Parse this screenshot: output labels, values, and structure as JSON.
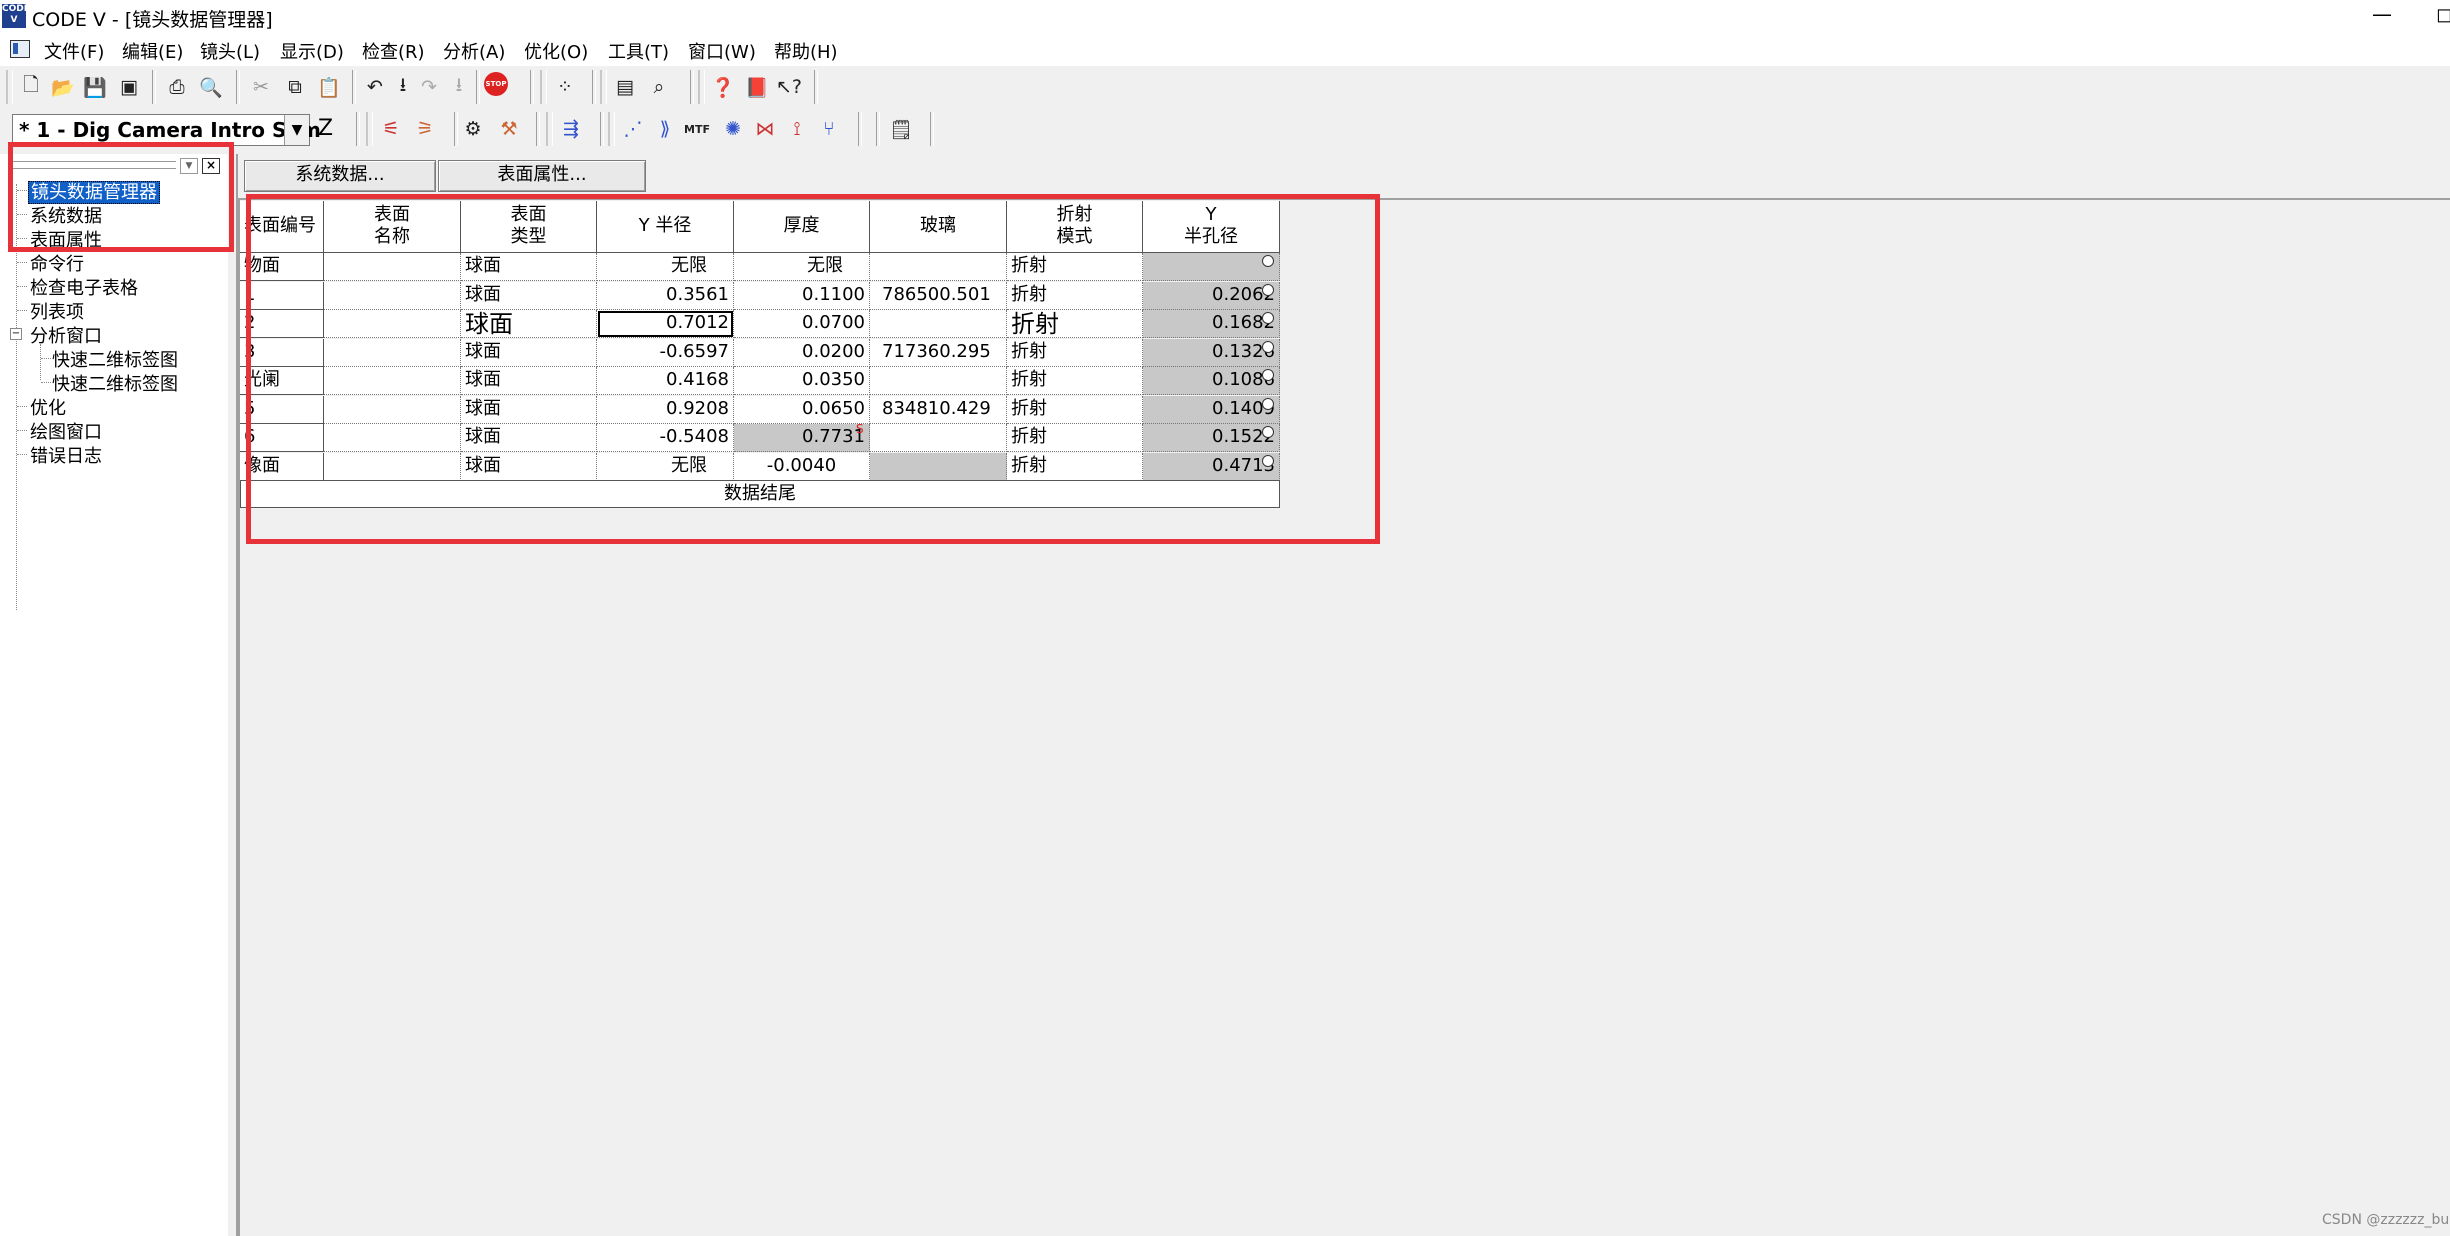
{
  "window": {
    "title": "CODE V - [镜头数据管理器]",
    "app_icon_label": "CODE V",
    "minimize_label": "—",
    "maximize_label": "◻"
  },
  "menu": {
    "items": [
      {
        "label": "文件(F)"
      },
      {
        "label": "编辑(E)"
      },
      {
        "label": "镜头(L)"
      },
      {
        "label": "显示(D)"
      },
      {
        "label": "检查(R)"
      },
      {
        "label": "分析(A)"
      },
      {
        "label": "优化(O)"
      },
      {
        "label": "工具(T)"
      },
      {
        "label": "窗口(W)"
      },
      {
        "label": "帮助(H)"
      }
    ]
  },
  "toolbar": {
    "lens_selector_value": "* 1 - Dig Camera Intro Sem",
    "z_label": "Z",
    "stop_label": "STOP",
    "mtf_label": "MTF",
    "icons": {
      "new": "new-file-icon",
      "open": "open-folder-icon",
      "save": "save-icon",
      "image": "image-icon",
      "print": "print-icon",
      "preview": "print-preview-icon",
      "cut": "cut-icon",
      "copy": "copy-icon",
      "paste": "paste-icon",
      "undo": "undo-icon",
      "redo": "redo-icon",
      "stop": "stop-icon"
    }
  },
  "tree": {
    "items": [
      {
        "label": "镜头数据管理器",
        "selected": true
      },
      {
        "label": "系统数据"
      },
      {
        "label": "表面属性"
      },
      {
        "label": "命令行"
      },
      {
        "label": "检查电子表格"
      },
      {
        "label": "列表项"
      },
      {
        "label": "分析窗口"
      },
      {
        "label": "快速二维标签图"
      },
      {
        "label": "快速二维标签图"
      },
      {
        "label": "优化"
      },
      {
        "label": "绘图窗口"
      },
      {
        "label": "错误日志"
      }
    ],
    "expander_label": "−"
  },
  "tabs": {
    "system_data": "系统数据...",
    "surface_props": "表面属性..."
  },
  "sheet": {
    "headers": [
      "表面编号",
      "表面\n名称",
      "表面\n类型",
      "Y 半径",
      "厚度",
      "玻璃",
      "折射\n模式",
      "Y\n半孔径"
    ],
    "rows": [
      {
        "id": "物面",
        "name": "",
        "type": "球面",
        "radius": "无限",
        "thickness": "无限",
        "glass": "",
        "mode": "折射",
        "aperture": ""
      },
      {
        "id": "1",
        "name": "",
        "type": "球面",
        "radius": "0.3561",
        "thickness": "0.1100",
        "glass": "786500.501",
        "mode": "折射",
        "aperture": "0.2062"
      },
      {
        "id": "2",
        "name": "",
        "type": "球面",
        "radius": "0.7012",
        "thickness": "0.0700",
        "glass": "",
        "mode": "折射",
        "aperture": "0.1682"
      },
      {
        "id": "3",
        "name": "",
        "type": "球面",
        "radius": "-0.6597",
        "thickness": "0.0200",
        "glass": "717360.295",
        "mode": "折射",
        "aperture": "0.1326"
      },
      {
        "id": "光阑",
        "name": "",
        "type": "球面",
        "radius": "0.4168",
        "thickness": "0.0350",
        "glass": "",
        "mode": "折射",
        "aperture": "0.1086"
      },
      {
        "id": "5",
        "name": "",
        "type": "球面",
        "radius": "0.9208",
        "thickness": "0.0650",
        "glass": "834810.429",
        "mode": "折射",
        "aperture": "0.1409"
      },
      {
        "id": "6",
        "name": "",
        "type": "球面",
        "radius": "-0.5408",
        "thickness": "0.7731",
        "glass": "",
        "mode": "折射",
        "aperture": "0.1522"
      },
      {
        "id": "像面",
        "name": "",
        "type": "球面",
        "radius": "无限",
        "thickness": "-0.0040",
        "glass": "",
        "mode": "折射",
        "aperture": "0.4713"
      }
    ],
    "solve_flag": "S",
    "end_label": "数据结尾"
  },
  "watermark": "CSDN @zzzzzz_bu",
  "colors": {
    "annotation_red": "#e8323a",
    "selection_blue": "#1060c8",
    "gray_cell": "#c8c8c8"
  }
}
